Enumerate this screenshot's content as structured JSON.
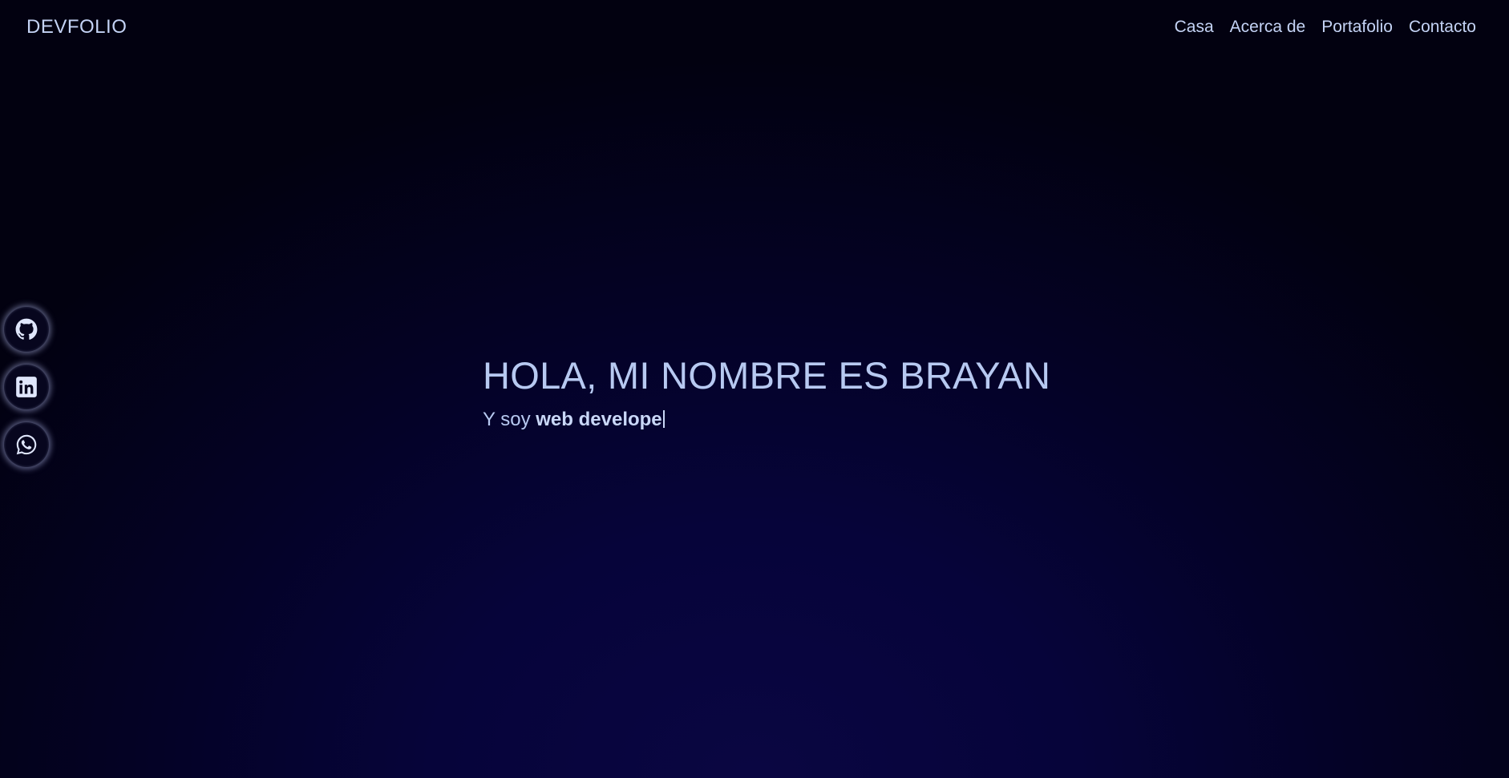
{
  "navbar": {
    "brand": "DEVFOLIO",
    "links": [
      "Casa",
      "Acerca de",
      "Portafolio",
      "Contacto"
    ]
  },
  "social": [
    {
      "icon": "github-icon"
    },
    {
      "icon": "linkedin-icon"
    },
    {
      "icon": "whatsapp-icon"
    }
  ],
  "hero": {
    "title": "HOLA, MI NOMBRE ES BRAYAN",
    "subtitle_prefix": "Y soy ",
    "typed_text": "web develope"
  },
  "colors": {
    "text": "#b7c9f1",
    "background_center": "#0a0642",
    "background_edge": "#020110"
  }
}
